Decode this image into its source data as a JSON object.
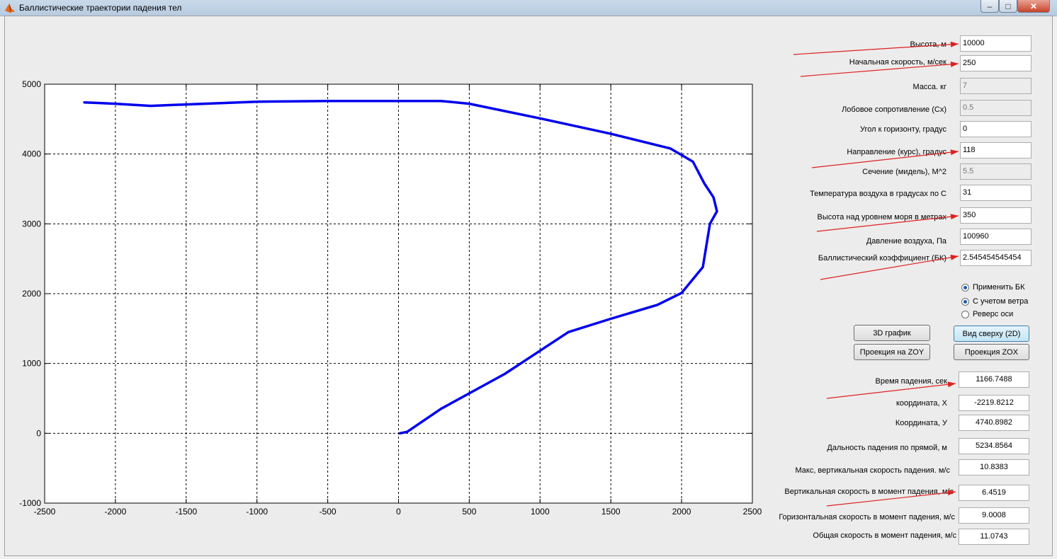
{
  "window": {
    "title": "Баллистические траектории падения тел",
    "minimize_glyph": "–",
    "maximize_glyph": "□",
    "close_glyph": "✕",
    "app_icon": "matlab-icon"
  },
  "inputs": [
    {
      "label": "Высота, м",
      "value": "10000",
      "enabled": true
    },
    {
      "label": "Начальная скорость, м/сек",
      "value": "250",
      "enabled": true
    },
    {
      "label": "Масса. кг",
      "value": "7",
      "enabled": false
    },
    {
      "label": "Лобовое сопротивление (Сх)",
      "value": "0.5",
      "enabled": false
    },
    {
      "label": "Угол к горизонту, градус",
      "value": "0",
      "enabled": true
    },
    {
      "label": "Направление  (курс), градус",
      "value": "118",
      "enabled": true
    },
    {
      "label": "Сечение (мидель), М^2",
      "value": "5.5",
      "enabled": false
    },
    {
      "label": "Температура воздуха в градусах по С",
      "value": "31",
      "enabled": true
    },
    {
      "label": "Высота над уровнем моря в метрах",
      "value": "350",
      "enabled": true
    },
    {
      "label": "Давление воздуха, Па",
      "value": "100960",
      "enabled": true
    },
    {
      "label": "Баллистический коэффициент (БК)",
      "value": "2.545454545454",
      "enabled": true
    }
  ],
  "options": [
    {
      "label": "Применить БК",
      "checked": true
    },
    {
      "label": "С учетом ветра",
      "checked": true
    },
    {
      "label": "Реверс оси",
      "checked": false
    }
  ],
  "buttons": {
    "plot3d": "3D график",
    "top_view": "Вид сверху (2D)",
    "proj_zoy": "Проекция на ZOY",
    "proj_zox": "Проекция ZOX"
  },
  "outputs": [
    {
      "label": "Время падения, сек",
      "value": "1166.7488"
    },
    {
      "label": "координата, X",
      "value": "-2219.8212"
    },
    {
      "label": "Координата, У",
      "value": "4740.8982"
    },
    {
      "label": "Дальность падения по прямой, м",
      "value": "5234.8564"
    },
    {
      "label": "Макс,  вертикальная скорость падения. м/с",
      "value": "10.8383"
    },
    {
      "label": "Вертикальная  скорость в момент падения, м/с",
      "value": "6.4519"
    },
    {
      "label": "Горизонтальная скорость в момент падения, м/с",
      "value": "9.0008"
    },
    {
      "label": "Общая скорость в момент падения, м/с",
      "value": "11.0743"
    }
  ],
  "colors": {
    "trajectory": "#0000ee",
    "annotation_arrow": "#e02020",
    "grid": "#000000"
  },
  "chart_data": {
    "type": "line",
    "title": "",
    "xlabel": "",
    "ylabel": "",
    "xlim": [
      -2500,
      2500
    ],
    "ylim": [
      -1000,
      5000
    ],
    "xticks": [
      -2500,
      -2000,
      -1500,
      -1000,
      -500,
      0,
      500,
      1000,
      1500,
      2000,
      2500
    ],
    "yticks": [
      -1000,
      0,
      1000,
      2000,
      3000,
      4000,
      5000
    ],
    "grid": true,
    "series": [
      {
        "x": [
          10,
          60,
          300,
          750,
          1200,
          1500,
          1830,
          2000,
          2150,
          2200,
          2250,
          2225,
          2160,
          2080,
          1920,
          1500,
          1000,
          500,
          300,
          0,
          -500,
          -1000,
          -1500,
          -1750,
          -2000,
          -2219
        ],
        "y": [
          0,
          20,
          350,
          850,
          1450,
          1640,
          1840,
          2010,
          2380,
          3000,
          3180,
          3380,
          3580,
          3890,
          4080,
          4290,
          4510,
          4720,
          4760,
          4760,
          4760,
          4750,
          4710,
          4690,
          4720,
          4740
        ]
      }
    ]
  }
}
